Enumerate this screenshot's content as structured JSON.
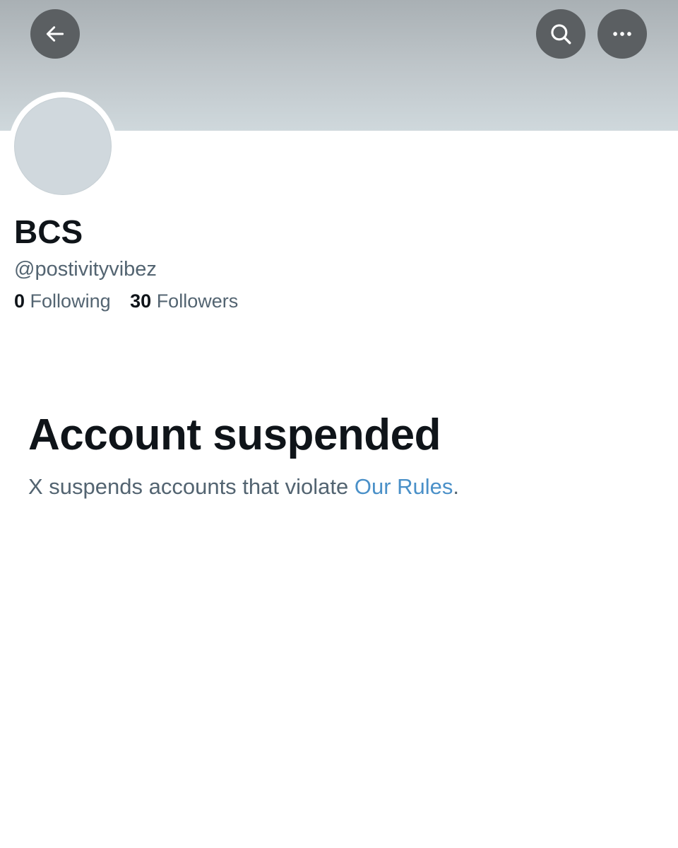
{
  "header": {
    "back_icon": "arrow-left-icon",
    "search_icon": "search-icon",
    "more_icon": "more-horizontal-icon"
  },
  "profile": {
    "display_name": "BCS",
    "handle": "@postivityvibez",
    "following_count": "0",
    "following_label": "Following",
    "followers_count": "30",
    "followers_label": "Followers"
  },
  "suspension": {
    "title": "Account suspended",
    "message_prefix": "X suspends accounts that violate ",
    "link_label": "Our Rules",
    "message_suffix": "."
  },
  "colors": {
    "banner_top": "#a9b0b4",
    "banner_bottom": "#cfd8dc",
    "icon_button_bg": "#5b5f62",
    "primary_text": "#0f1419",
    "secondary_text": "#536471",
    "link": "#4a90c8",
    "avatar_placeholder": "#d0d8dd"
  }
}
